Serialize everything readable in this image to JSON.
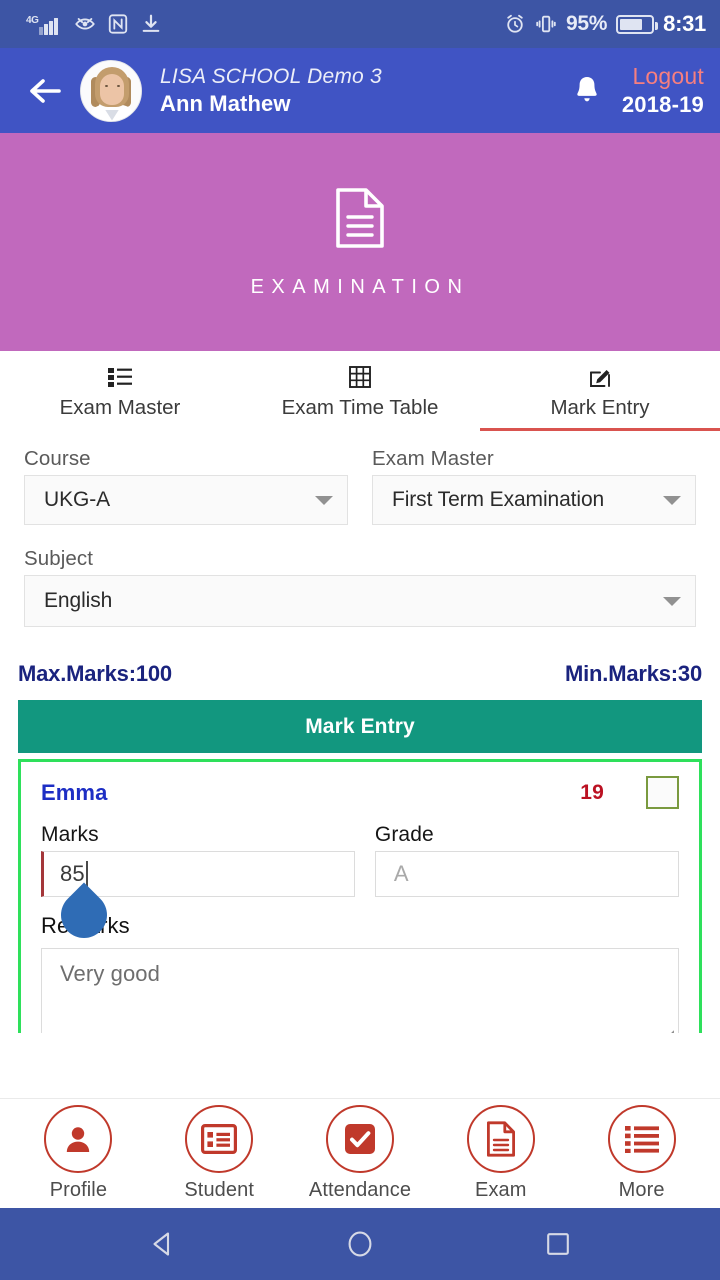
{
  "status_bar": {
    "network": "4G",
    "icons": [
      "signal-icon",
      "eye-icon",
      "nfc-icon",
      "download-icon",
      "alarm-icon",
      "vibrate-icon",
      "battery-icon"
    ],
    "battery_percent": "95%",
    "time": "8:31"
  },
  "app_bar": {
    "back_icon": "back-arrow-icon",
    "avatar": "user-avatar",
    "school": "LISA SCHOOL Demo 3",
    "user": "Ann Mathew",
    "bell_icon": "notification-bell-icon",
    "logout_label": "Logout",
    "academic_year": "2018-19"
  },
  "banner": {
    "icon": "document-icon",
    "title": "EXAMINATION",
    "color": "#c169bd"
  },
  "tabs": [
    {
      "label": "Exam Master",
      "icon": "list-icon",
      "active": false
    },
    {
      "label": "Exam Time Table",
      "icon": "table-grid-icon",
      "active": false
    },
    {
      "label": "Mark Entry",
      "icon": "edit-pencil-icon",
      "active": true
    }
  ],
  "accent_colors": {
    "active_tab_underline": "#d9534f",
    "header": "#4054c4",
    "mark_entry_bar": "#12977f",
    "card_border": "#2ee05b",
    "nav_icon": "#c0392b"
  },
  "filters": {
    "course": {
      "label": "Course",
      "value": "UKG-A"
    },
    "exam_master": {
      "label": "Exam Master",
      "value": "First Term Examination"
    },
    "subject": {
      "label": "Subject",
      "value": "English"
    }
  },
  "marks_info": {
    "max": "Max.Marks:100",
    "min": "Min.Marks:30"
  },
  "section_header": "Mark Entry",
  "student_card": {
    "name": "Emma",
    "roll_number": "19",
    "checkbox_checked": false,
    "marks": {
      "label": "Marks",
      "value": "85"
    },
    "grade": {
      "label": "Grade",
      "placeholder": "A",
      "value": ""
    },
    "remarks": {
      "label": "Remarks",
      "value": "Very good"
    }
  },
  "bottom_nav": [
    {
      "label": "Profile",
      "icon": "person-icon"
    },
    {
      "label": "Student",
      "icon": "student-card-icon"
    },
    {
      "label": "Attendance",
      "icon": "checkbox-check-icon"
    },
    {
      "label": "Exam",
      "icon": "document-icon"
    },
    {
      "label": "More",
      "icon": "list-lines-icon"
    }
  ],
  "android_nav": {
    "back": "back-triangle-icon",
    "home": "home-circle-icon",
    "recents": "recents-square-icon"
  }
}
